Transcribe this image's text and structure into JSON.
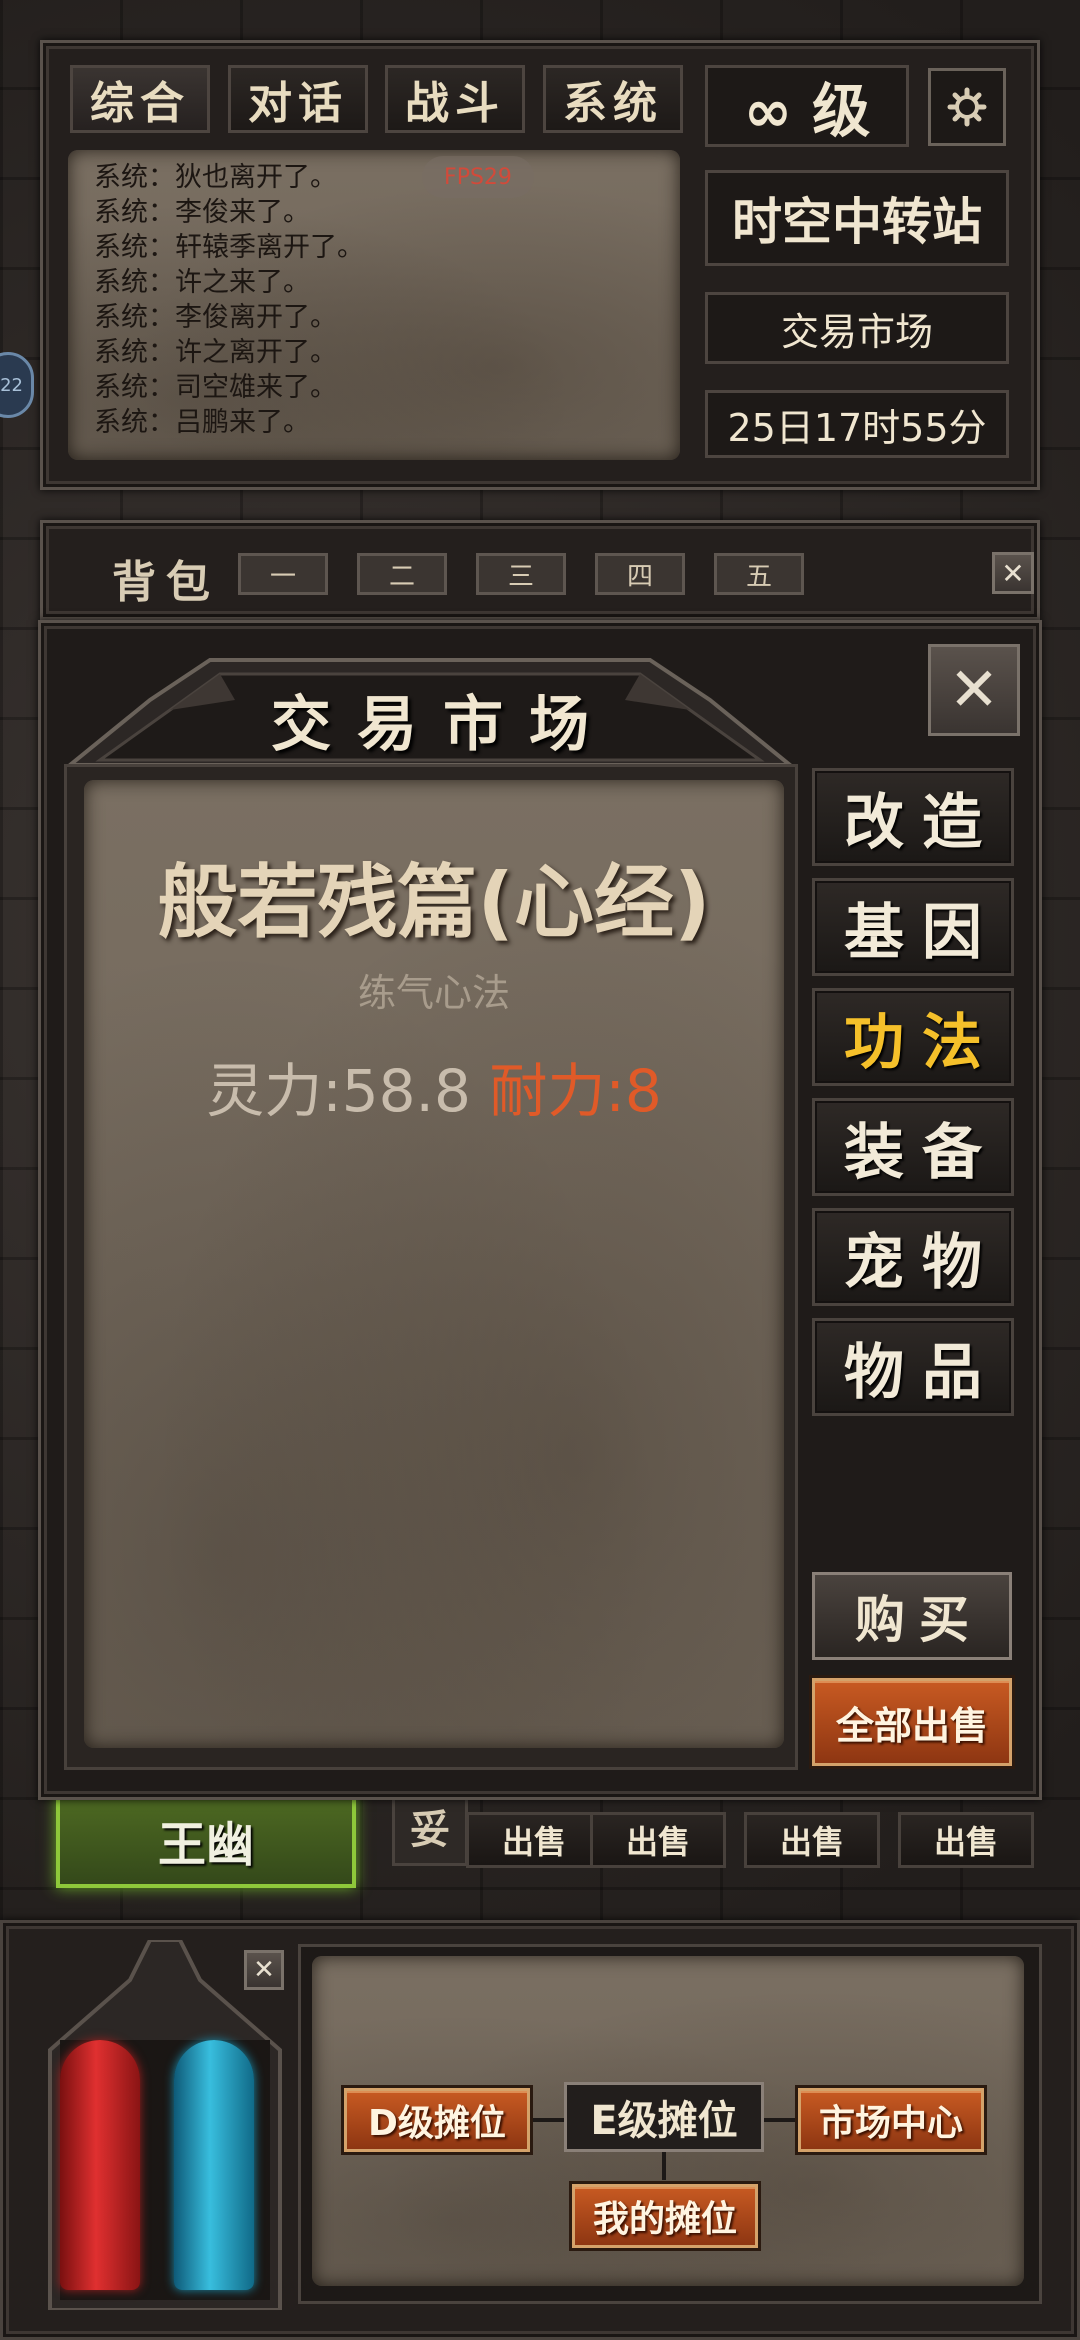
{
  "chat": {
    "tabs": [
      "综合",
      "对话",
      "战斗",
      "系统"
    ],
    "fps": "FPS29",
    "lines": [
      "系统：狄也离开了。",
      "系统：李俊来了。",
      "系统：轩辕季离开了。",
      "系统：许之来了。",
      "系统：李俊离开了。",
      "系统：许之离开了。",
      "系统：司空雄来了。",
      "系统：吕鹏来了。"
    ]
  },
  "status": {
    "level": "∞ 级",
    "location": "时空中转站",
    "sub_location": "交易市场",
    "time": "25日17时55分",
    "side_badge": "22"
  },
  "bag": {
    "title": "背包",
    "tabs": [
      "一",
      "二",
      "三",
      "四",
      "五"
    ]
  },
  "market": {
    "title": "交易市场",
    "item": {
      "name": "般若残篇(心经)",
      "type": "练气心法",
      "stat1": "灵力:58.8",
      "stat2": "耐力:8"
    },
    "categories": [
      "改造",
      "基因",
      "功法",
      "装备",
      "宠物",
      "物品"
    ],
    "active_category": "功法",
    "buy": "购买",
    "sell_all": "全部出售"
  },
  "behind": {
    "player_name": "王幽",
    "slot_char": "妥",
    "sell_buttons": [
      "出售",
      "出售",
      "出售",
      "出售"
    ]
  },
  "stalls": {
    "d": "D级摊位",
    "e": "E级摊位",
    "center": "市场中心",
    "mine": "我的摊位"
  },
  "colors": {
    "accent_yellow": "#f5c02a",
    "stat_orange": "#e05a28",
    "hp_red": "#d02828",
    "mp_blue": "#2aa6c8"
  }
}
